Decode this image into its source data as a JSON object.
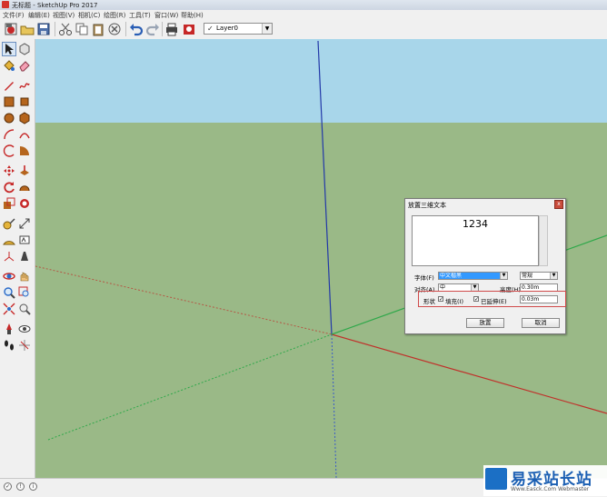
{
  "window": {
    "title": "无标题 - SketchUp Pro 2017"
  },
  "menu": [
    "文件(F)",
    "编辑(E)",
    "视图(V)",
    "相机(C)",
    "绘图(R)",
    "工具(T)",
    "窗口(W)",
    "帮助(H)"
  ],
  "toolbar": {
    "layer": {
      "check": "✓",
      "name": "Layer0"
    }
  },
  "dialog": {
    "title": "放置三维文本",
    "text": "1234",
    "font_label": "字体(F)",
    "font_value": "中文楷黑",
    "style_value": "常规",
    "align_label": "对齐(A)",
    "align_value": "中",
    "height_label": "高度(H)",
    "height_value": "0.30m",
    "form_label": "形状",
    "fill_label": "填充(I)",
    "extrude_label": "已延伸(E)",
    "extrude_value": "0.03m",
    "place_button": "放置",
    "cancel_button": "取消",
    "close_symbol": "x"
  },
  "statusbar": {
    "icons": [
      "✓",
      "!",
      "i"
    ]
  },
  "watermark": {
    "name": "易采站长站",
    "url": "Www.Easck.Com  Webmaster"
  },
  "colors": {
    "sky": "#a8d6ea",
    "ground": "#9ab987",
    "blue_axis": "#2238a8",
    "red_axis": "#c0302a",
    "green_axis": "#2fa84a",
    "highlight": "#d04a4a"
  }
}
